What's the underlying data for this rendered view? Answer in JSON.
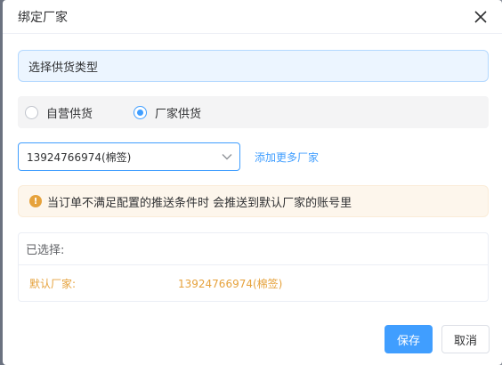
{
  "dialog": {
    "title": "绑定厂家",
    "supply_type_label": "选择供货类型",
    "radio_options": [
      {
        "label": "自营供货",
        "checked": false
      },
      {
        "label": "厂家供货",
        "checked": true
      }
    ],
    "select": {
      "value": "13924766974(棉签)"
    },
    "add_link": "添加更多厂家",
    "warning": "当订单不满足配置的推送条件时 会推送到默认厂家的账号里",
    "selected": {
      "heading": "已选择:",
      "row_label": "默认厂家:",
      "row_value": "13924766974(棉签)"
    },
    "buttons": {
      "save": "保存",
      "cancel": "取消"
    }
  },
  "colors": {
    "primary": "#409eff",
    "warning": "#e6a23c",
    "info_bg": "#ecf5ff",
    "warning_bg": "#fdf6ec"
  },
  "icons": {
    "close": "close-icon",
    "dropdown": "chevron-down-icon",
    "warning": "exclamation-circle-icon"
  }
}
